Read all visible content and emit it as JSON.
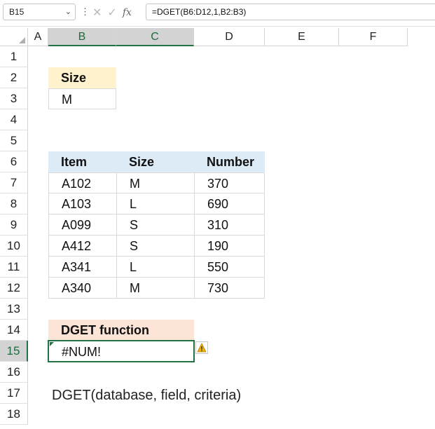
{
  "formula_bar": {
    "name_box": "B15",
    "formula": "=DGET(B6:D12,1,B2:B3)"
  },
  "columns": [
    "A",
    "B",
    "C",
    "D",
    "E",
    "F"
  ],
  "rows": [
    "1",
    "2",
    "3",
    "4",
    "5",
    "6",
    "7",
    "8",
    "9",
    "10",
    "11",
    "12",
    "13",
    "14",
    "15",
    "16",
    "17",
    "18"
  ],
  "criteria": {
    "header": "Size",
    "value": "M"
  },
  "table": {
    "headers": [
      "Item",
      "Size",
      "Number"
    ],
    "rows": [
      [
        "A102",
        "M",
        "370"
      ],
      [
        "A103",
        "L",
        "690"
      ],
      [
        "A099",
        "S",
        "310"
      ],
      [
        "A412",
        "S",
        "190"
      ],
      [
        "A341",
        "L",
        "550"
      ],
      [
        "A340",
        "M",
        "730"
      ]
    ]
  },
  "result": {
    "header": "DGET function",
    "value": "#NUM!"
  },
  "syntax_note": "DGET(database, field, criteria)",
  "colors": {
    "accent": "#217346",
    "criteria_header": "#fff2cc",
    "table_header": "#ddebf7",
    "result_header": "#fce4d6",
    "warning": "#f2b300"
  },
  "icons": [
    "chevron-down-icon",
    "cancel-icon",
    "enter-icon",
    "function-icon",
    "warning-icon"
  ]
}
